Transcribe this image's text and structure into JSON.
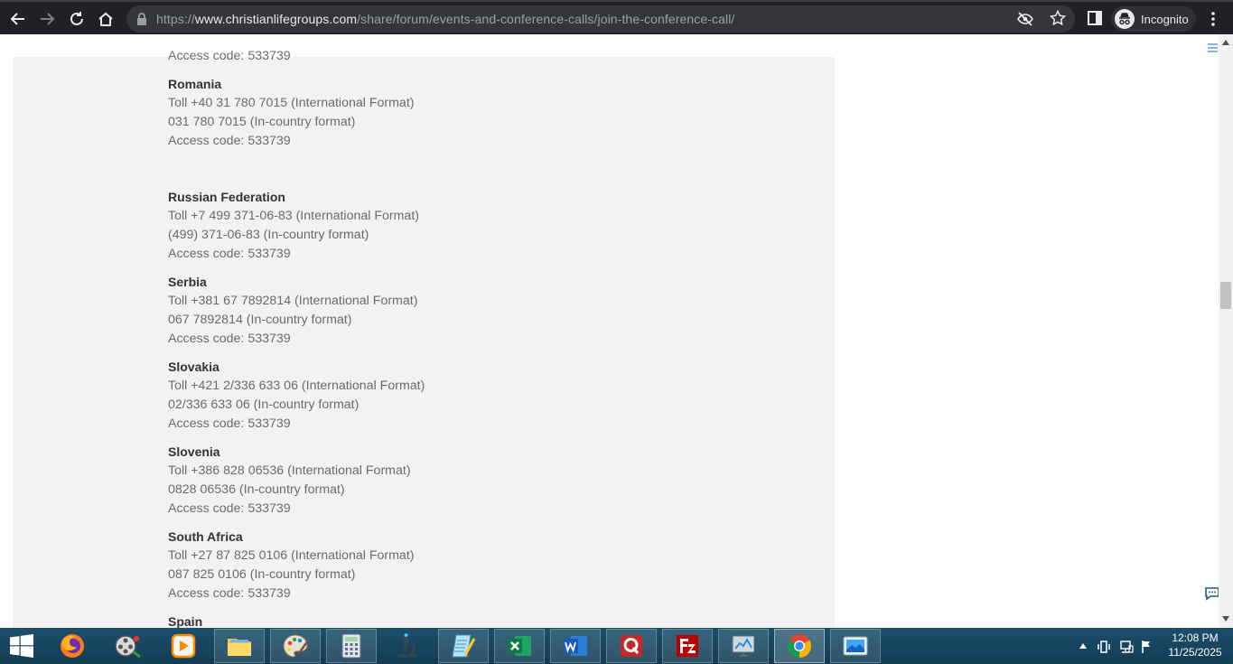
{
  "browser": {
    "url_scheme": "https://",
    "url_host": "www.christianlifegroups.com",
    "url_path": "/share/forum/events-and-conference-calls/join-the-conference-call/",
    "profile_label": "Incognito"
  },
  "page": {
    "top_cut_line": "Access code: 533739",
    "entries": [
      {
        "country": "Romania",
        "intl": "Toll +40 31 780 7015 (International Format)",
        "local": "031 780 7015 (In-country format)",
        "access": "Access code: 533739"
      },
      {
        "country": "Russian Federation",
        "intl": "Toll +7 499 371-06-83 (International Format)",
        "local": "(499) 371-06-83 (In-country format)",
        "access": "Access code: 533739"
      },
      {
        "country": "Serbia",
        "intl": "Toll +381 67 7892814 (International Format)",
        "local": "067 7892814 (In-country format)",
        "access": "Access code: 533739"
      },
      {
        "country": "Slovakia",
        "intl": "Toll +421 2/336 633 06 (International Format)",
        "local": "02/336 633 06 (In-country format)",
        "access": "Access code: 533739"
      },
      {
        "country": "Slovenia",
        "intl": "Toll +386 828 06536 (International Format)",
        "local": "0828 06536 (In-country format)",
        "access": "Access code: 533739"
      },
      {
        "country": "South Africa",
        "intl": "Toll +27 87 825 0106 (International Format)",
        "local": "087 825 0106 (In-country format)",
        "access": "Access code: 533739"
      }
    ],
    "bottom_cut_country": "Spain"
  },
  "taskbar": {
    "apps": [
      "firefox",
      "media-player",
      "video-player",
      "file-explorer",
      "paint",
      "calculator",
      "microscope-app",
      "notepad",
      "excel",
      "word",
      "q-app",
      "filezilla",
      "system-tool",
      "chrome",
      "screenshot-tool"
    ],
    "active_app": "chrome"
  },
  "clock": {
    "time": "12:08 PM",
    "date": "11/25/2025"
  },
  "colors": {
    "chrome_bg": "#202124",
    "omnibox_bg": "#35363a",
    "content_bg": "#f2f2f2",
    "taskbar_bg": "#1b4f6c"
  }
}
